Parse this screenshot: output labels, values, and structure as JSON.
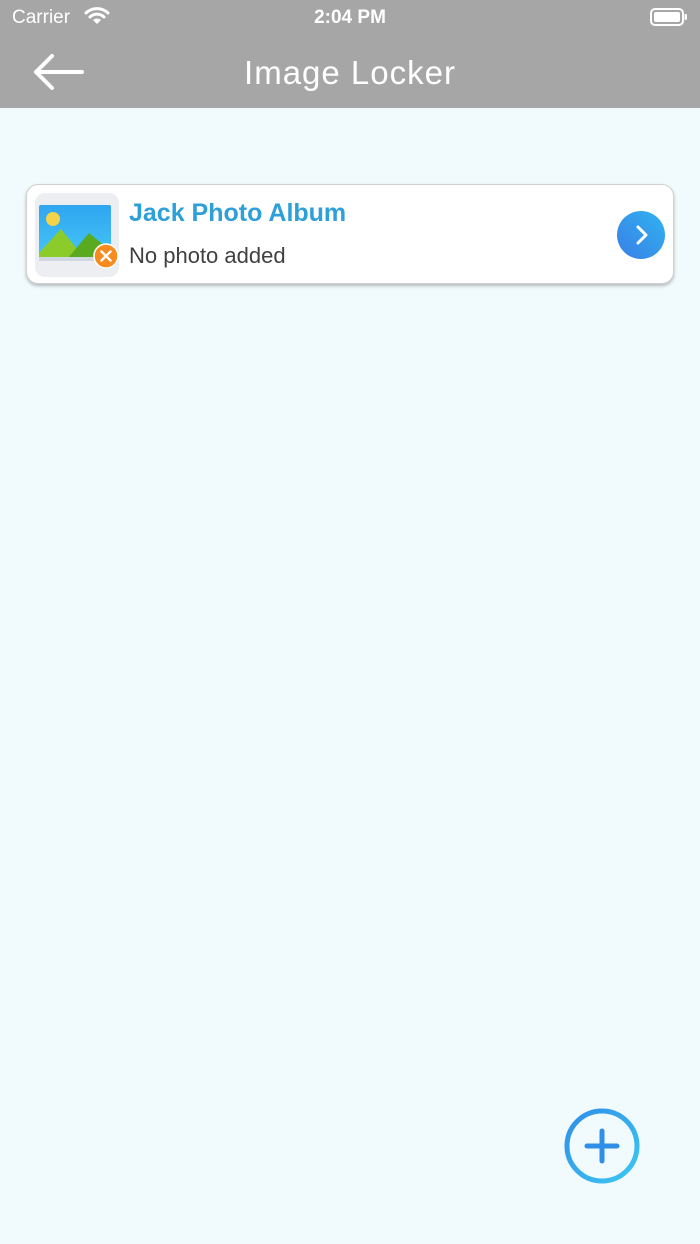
{
  "status_bar": {
    "carrier": "Carrier",
    "time": "2:04 PM"
  },
  "nav": {
    "title": "Image Locker",
    "back_icon": "arrow-left-icon"
  },
  "albums": [
    {
      "name": "Jack Photo Album",
      "subtitle": "No photo added",
      "thumbnail_icon": "image-icon",
      "badge_icon": "close-circle-icon",
      "action_icon": "chevron-right-icon"
    }
  ],
  "fab": {
    "icon": "plus-circle-icon"
  },
  "colors": {
    "header_bg": "#a6a6a6",
    "page_bg": "#f1fafd",
    "album_title": "#2d9fd9",
    "accent_blue": "#2f8fe8",
    "badge_orange": "#f68b1f"
  }
}
